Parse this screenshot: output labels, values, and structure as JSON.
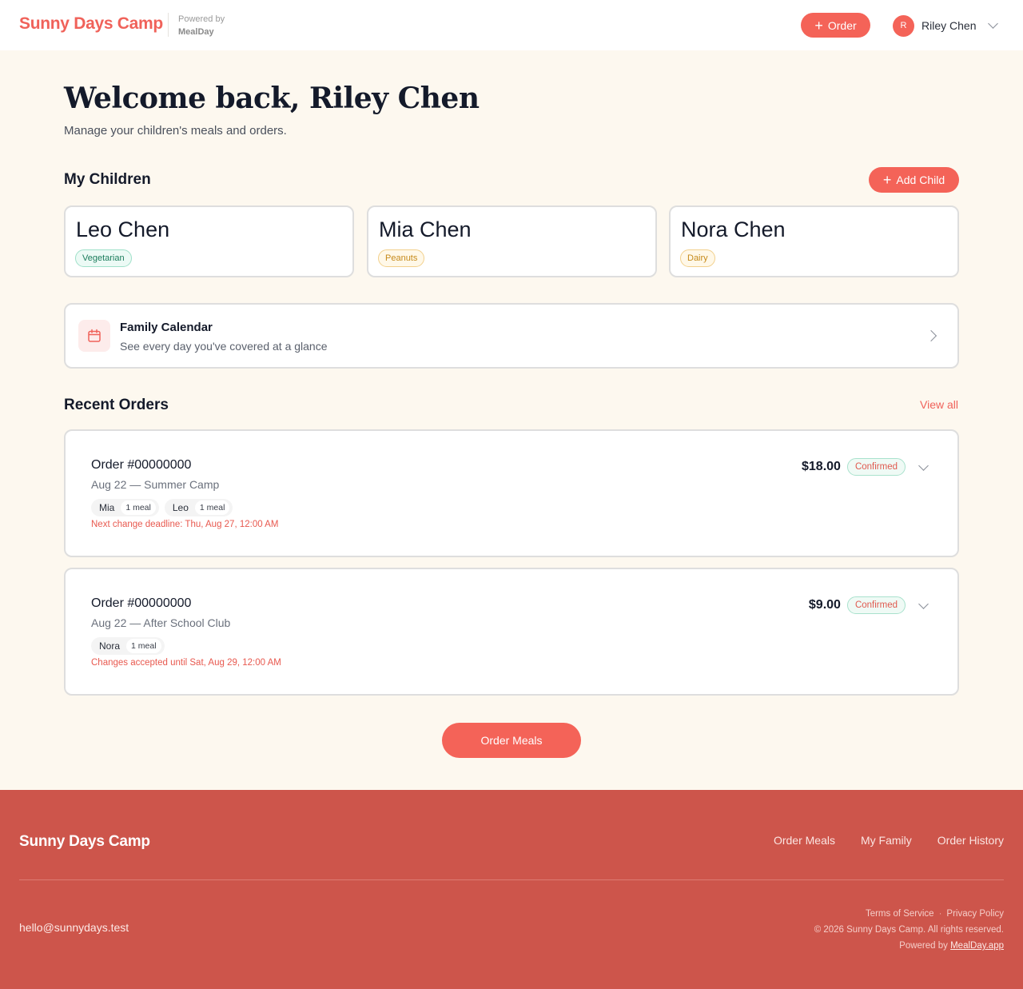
{
  "header": {
    "brand": "Sunny Days Camp",
    "powered_by_label": "Powered by",
    "powered_by_name": "MealDay",
    "order_button": "Order",
    "user_initial": "R",
    "user_name": "Riley Chen"
  },
  "welcome": {
    "title": "Welcome back, Riley Chen",
    "subtitle": "Manage your children's meals and orders."
  },
  "children_section": {
    "title": "My Children",
    "add_button": "Add Child",
    "children": [
      {
        "name": "Leo Chen",
        "tag": "Vegetarian",
        "tag_color": "#1a7c5b"
      },
      {
        "name": "Mia Chen",
        "tag": "Peanuts",
        "tag_color": "#c68a1a"
      },
      {
        "name": "Nora Chen",
        "tag": "Dairy",
        "tag_color": "#c68a1a"
      }
    ]
  },
  "calendar": {
    "title": "Family Calendar",
    "subtitle": "See every day you've covered at a glance"
  },
  "orders_section": {
    "title": "Recent Orders",
    "view_all": "View all",
    "orders": [
      {
        "number": "Order #00000000",
        "subtitle": "Aug 22 — Summer Camp",
        "price": "$18.00",
        "status": "Confirmed",
        "items": [
          {
            "name": "Mia",
            "count": "1 meal"
          },
          {
            "name": "Leo",
            "count": "1 meal"
          }
        ],
        "note": "Next change deadline: Thu, Aug 27, 12:00 AM"
      },
      {
        "number": "Order #00000000",
        "subtitle": "Aug 22 — After School Club",
        "price": "$9.00",
        "status": "Confirmed",
        "items": [
          {
            "name": "Nora",
            "count": "1 meal"
          }
        ],
        "note": "Changes accepted until Sat, Aug 29, 12:00 AM"
      }
    ]
  },
  "order_meals_button": "Order Meals",
  "footer": {
    "brand": "Sunny Days Camp",
    "nav": [
      "Order Meals",
      "My Family",
      "Order History"
    ],
    "email": "hello@sunnydays.test",
    "terms": "Terms of Service",
    "privacy": "Privacy Policy",
    "copyright": "© 2026 Sunny Days Camp. All rights reserved.",
    "powered_prefix": "Powered by",
    "powered_link": "MealDay.app"
  },
  "colors": {
    "accent": "#f46358",
    "page_bg": "#fdf8ef",
    "footer_bg": "#cd554b"
  }
}
